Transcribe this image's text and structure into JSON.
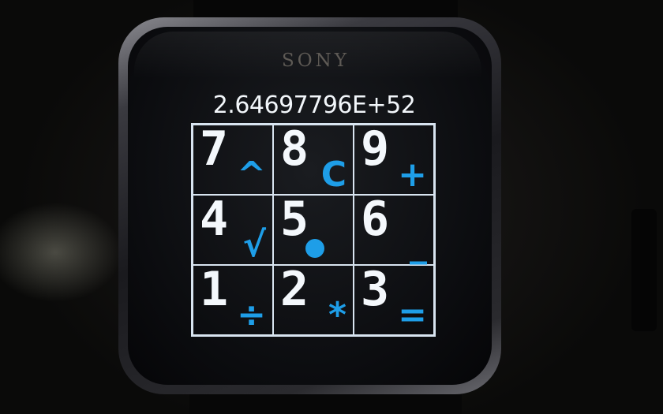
{
  "device": {
    "brand": "SONY"
  },
  "display": {
    "value": "2.64697796E+52"
  },
  "keypad": {
    "rows": [
      [
        {
          "digit": "7",
          "op": "^"
        },
        {
          "digit": "8",
          "op": "C"
        },
        {
          "digit": "9",
          "op": "+"
        }
      ],
      [
        {
          "digit": "4",
          "op": "√"
        },
        {
          "digit": "5",
          "op": "•"
        },
        {
          "digit": "6",
          "op": "_"
        }
      ],
      [
        {
          "digit": "1",
          "op": "÷"
        },
        {
          "digit": "2",
          "op": "*"
        },
        {
          "digit": "3",
          "op": "="
        }
      ]
    ]
  },
  "colors": {
    "digit": "#f4f8fc",
    "operator": "#1e9ee8",
    "grid": "#d8e4f0",
    "screen": "#0b0c0f"
  }
}
